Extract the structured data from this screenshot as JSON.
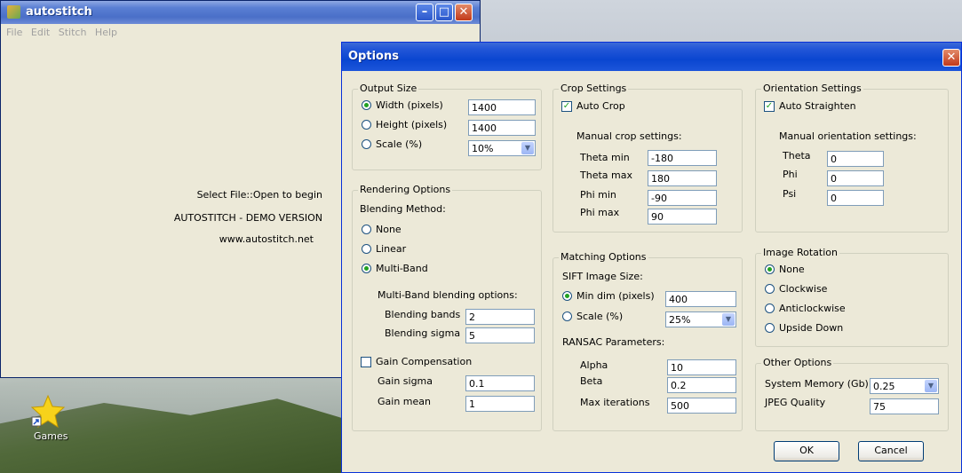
{
  "main_window": {
    "title": "autostitch",
    "menu": [
      "File",
      "Edit",
      "Stitch",
      "Help"
    ],
    "status_lines": [
      "Select File::Open to begin",
      "AUTOSTITCH - DEMO VERSION",
      "www.autostitch.net"
    ]
  },
  "desktop": {
    "games_label": "Games"
  },
  "options": {
    "title": "Options",
    "output_size": {
      "title": "Output Size",
      "width_label": "Width (pixels)",
      "width_value": "1400",
      "height_label": "Height (pixels)",
      "height_value": "1400",
      "scale_label": "Scale (%)",
      "scale_value": "10%"
    },
    "rendering": {
      "title": "Rendering Options",
      "blending_method": "Blending Method:",
      "none": "None",
      "linear": "Linear",
      "multiband": "Multi-Band",
      "multiband_opts": "Multi-Band blending options:",
      "bands_label": "Blending bands",
      "bands_value": "2",
      "sigma_label": "Blending sigma",
      "sigma_value": "5",
      "gain_comp": "Gain Compensation",
      "gain_sigma_label": "Gain sigma",
      "gain_sigma_value": "0.1",
      "gain_mean_label": "Gain mean",
      "gain_mean_value": "1"
    },
    "crop": {
      "title": "Crop Settings",
      "auto_crop": "Auto Crop",
      "manual": "Manual crop settings:",
      "theta_min_label": "Theta min",
      "theta_min_value": "-180",
      "theta_max_label": "Theta max",
      "theta_max_value": "180",
      "phi_min_label": "Phi min",
      "phi_min_value": "-90",
      "phi_max_label": "Phi max",
      "phi_max_value": "90"
    },
    "matching": {
      "title": "Matching Options",
      "sift": "SIFT Image Size:",
      "min_dim_label": "Min dim (pixels)",
      "min_dim_value": "400",
      "scale_label": "Scale (%)",
      "scale_value": "25%",
      "ransac": "RANSAC Parameters:",
      "alpha_label": "Alpha",
      "alpha_value": "10",
      "beta_label": "Beta",
      "beta_value": "0.2",
      "max_iter_label": "Max iterations",
      "max_iter_value": "500"
    },
    "orientation": {
      "title": "Orientation Settings",
      "auto_straighten": "Auto Straighten",
      "manual": "Manual orientation settings:",
      "theta_label": "Theta",
      "theta_value": "0",
      "phi_label": "Phi",
      "phi_value": "0",
      "psi_label": "Psi",
      "psi_value": "0"
    },
    "rotation": {
      "title": "Image Rotation",
      "none": "None",
      "clockwise": "Clockwise",
      "anticlockwise": "Anticlockwise",
      "upside_down": "Upside Down"
    },
    "other": {
      "title": "Other Options",
      "memory_label": "System Memory (Gb)",
      "memory_value": "0.25",
      "jpeg_label": "JPEG Quality",
      "jpeg_value": "75"
    },
    "ok": "OK",
    "cancel": "Cancel"
  }
}
